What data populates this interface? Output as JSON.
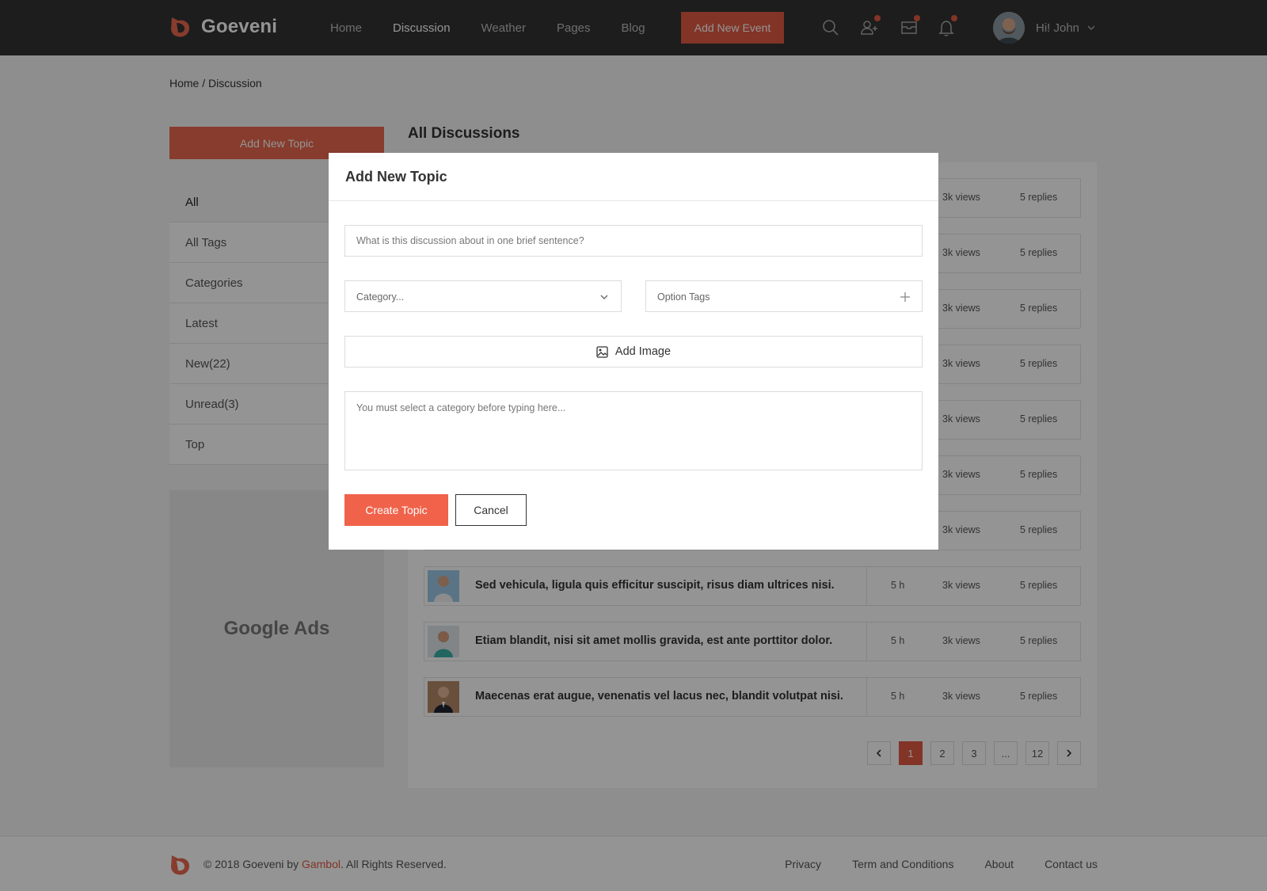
{
  "header": {
    "brand": "Goeveni",
    "nav": [
      "Home",
      "Discussion",
      "Weather",
      "Pages",
      "Blog"
    ],
    "active_nav": "Discussion",
    "add_event_label": "Add New Event",
    "greeting": "Hi! John",
    "icons": [
      "search-icon",
      "add-friend-icon",
      "mail-icon",
      "bell-icon"
    ],
    "accent_color": "#e05a44"
  },
  "breadcrumb": "Home / Discussion",
  "sidebar": {
    "add_topic_label": "Add New Topic",
    "items": [
      "All",
      "All Tags",
      "Categories",
      "Latest",
      "New(22)",
      "Unread(3)",
      "Top"
    ],
    "ads_label": "Google Ads"
  },
  "discussions": {
    "title": "All Discussions",
    "rows": [
      {
        "title": "",
        "time": "",
        "views": "3k views",
        "replies": "5 replies"
      },
      {
        "title": "",
        "time": "",
        "views": "3k views",
        "replies": "5 replies"
      },
      {
        "title": "",
        "time": "",
        "views": "3k views",
        "replies": "5 replies"
      },
      {
        "title": "",
        "time": "",
        "views": "3k views",
        "replies": "5 replies"
      },
      {
        "title": "",
        "time": "",
        "views": "3k views",
        "replies": "5 replies"
      },
      {
        "title": "",
        "time": "",
        "views": "3k views",
        "replies": "5 replies"
      },
      {
        "title": "",
        "time": "",
        "views": "3k views",
        "replies": "5 replies"
      },
      {
        "title": "Sed vehicula, ligula quis efficitur suscipit, risus diam ultrices nisi.",
        "time": "5 h",
        "views": "3k views",
        "replies": "5 replies"
      },
      {
        "title": "Etiam blandit, nisi sit amet mollis gravida, est ante porttitor dolor.",
        "time": "5 h",
        "views": "3k views",
        "replies": "5 replies"
      },
      {
        "title": "Maecenas erat augue, venenatis vel lacus nec, blandit volutpat nisi.",
        "time": "5 h",
        "views": "3k views",
        "replies": "5 replies"
      }
    ]
  },
  "pagination": {
    "pages": [
      "1",
      "2",
      "3",
      "...",
      "12"
    ],
    "current": "1"
  },
  "modal": {
    "title": "Add New Topic",
    "topic_placeholder": "What is this discussion about in one brief sentence?",
    "category_placeholder": "Category...",
    "tags_placeholder": "Option Tags",
    "add_image_label": "Add Image",
    "body_placeholder": "You must select a category before typing here...",
    "create_label": "Create Topic",
    "cancel_label": "Cancel"
  },
  "footer": {
    "copyright_prefix": "2018 Goeveni by",
    "copyright_brand": "Gambol",
    "copyright_suffix": ". All Rights Reserved.",
    "links": [
      "Privacy",
      "Term and Conditions",
      "About",
      "Contact us"
    ]
  }
}
